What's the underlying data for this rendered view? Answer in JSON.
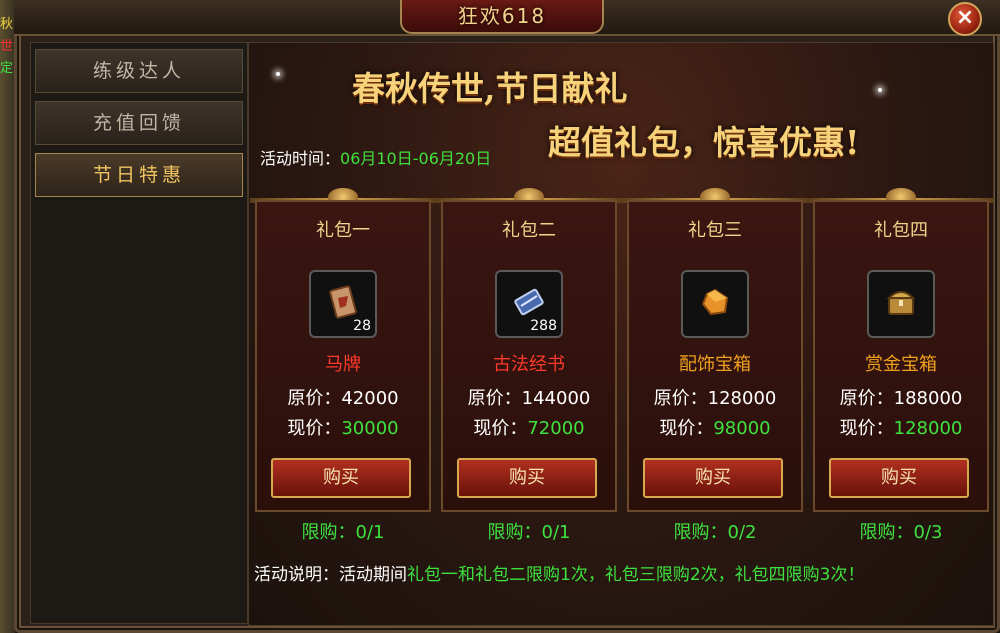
{
  "side_glyphs": [
    "秋",
    "世",
    "定"
  ],
  "title": "狂欢618",
  "close_label": "×",
  "tabs": [
    {
      "label": "练级达人"
    },
    {
      "label": "充值回馈"
    },
    {
      "label": "节日特惠"
    }
  ],
  "banner": {
    "line1": "春秋传世,节日献礼",
    "line2": "超值礼包，惊喜优惠!"
  },
  "activity_time": {
    "label": "活动时间：",
    "value": "06月10日-06月20日"
  },
  "packages": [
    {
      "name": "礼包一",
      "item": "马牌",
      "item_color": "#ff3a2a",
      "qty": "28",
      "original_label": "原价：",
      "original": "42000",
      "current_label": "现价：",
      "current": "30000",
      "buy_label": "购买",
      "limit": "限购：0/1",
      "icon": "horse-token-icon"
    },
    {
      "name": "礼包二",
      "item": "古法经书",
      "item_color": "#ff3a2a",
      "qty": "288",
      "original_label": "原价：",
      "original": "144000",
      "current_label": "现价：",
      "current": "72000",
      "buy_label": "购买",
      "limit": "限购：0/1",
      "icon": "scroll-book-icon"
    },
    {
      "name": "礼包三",
      "item": "配饰宝箱",
      "item_color": "#f0a020",
      "qty": "",
      "original_label": "原价：",
      "original": "128000",
      "current_label": "现价：",
      "current": "98000",
      "buy_label": "购买",
      "limit": "限购：0/2",
      "icon": "accessory-box-icon"
    },
    {
      "name": "礼包四",
      "item": "赏金宝箱",
      "item_color": "#f0a020",
      "qty": "",
      "original_label": "原价：",
      "original": "188000",
      "current_label": "现价：",
      "current": "128000",
      "buy_label": "购买",
      "limit": "限购：0/3",
      "icon": "treasure-chest-icon"
    }
  ],
  "description": {
    "label": "活动说明：活动期间",
    "text": "礼包一和礼包二限购1次，礼包三限购2次，礼包四限购3次！"
  },
  "colors": {
    "gold": "#f2d38a",
    "green": "#3ee23e",
    "red_text": "#ff3a2a",
    "orange_text": "#f0a020",
    "button_red": "#b0301f"
  }
}
